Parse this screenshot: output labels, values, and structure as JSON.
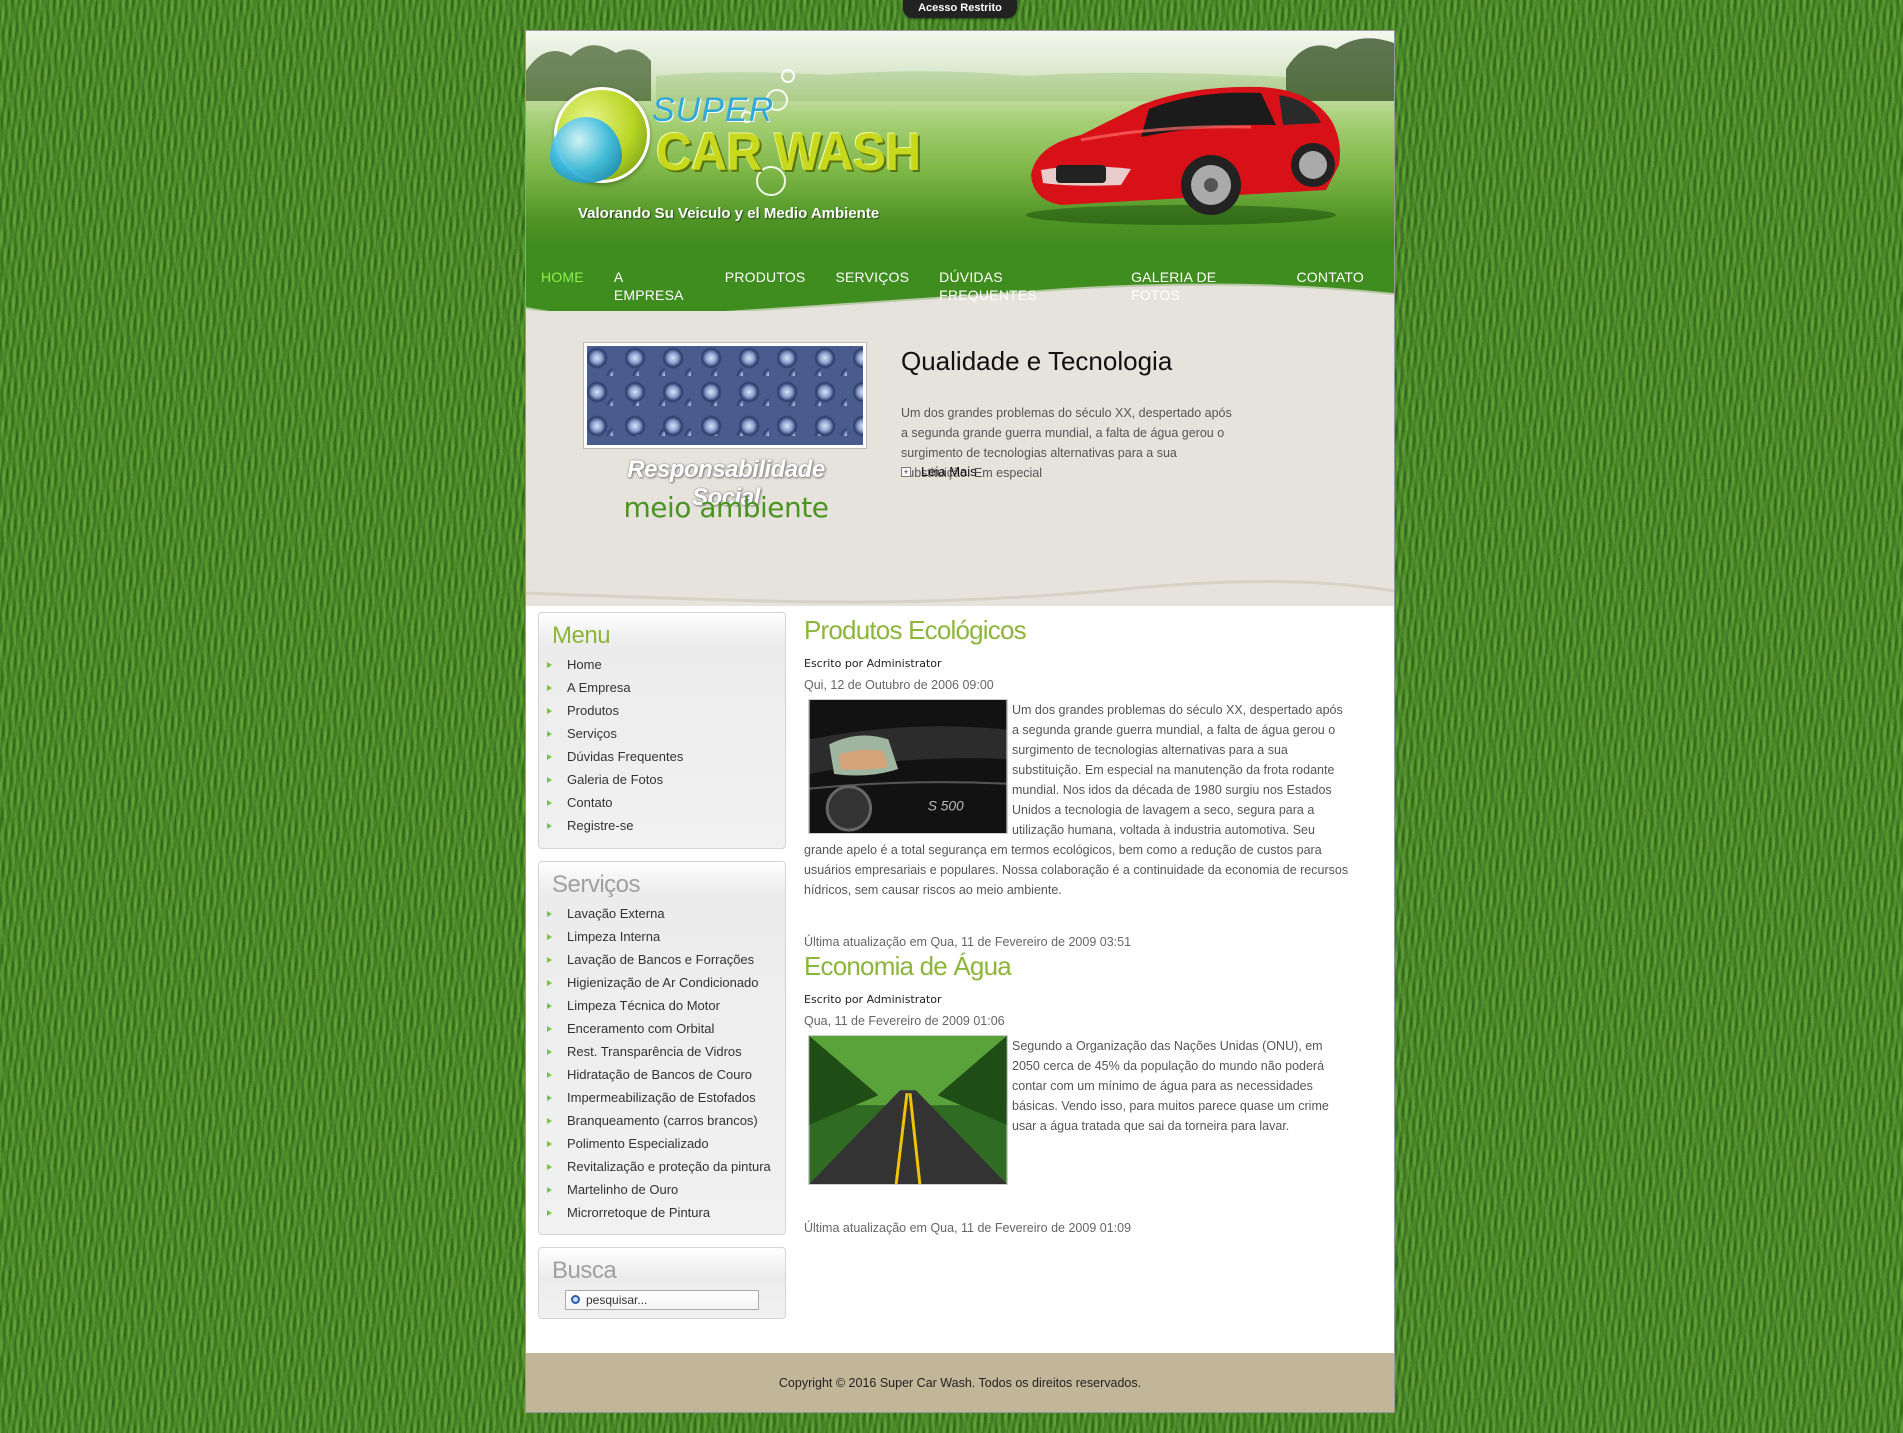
{
  "top_bar": {
    "access_label": "Acesso Restrito"
  },
  "header": {
    "logo_super": "SUPER",
    "logo_name": "CAR WASH",
    "tagline": "Valorando Su Veiculo y el Medio Ambiente"
  },
  "nav": {
    "items": [
      {
        "label": "HOME",
        "active": true
      },
      {
        "label": "A EMPRESA"
      },
      {
        "label": "PRODUTOS"
      },
      {
        "label": "SERVIÇOS"
      },
      {
        "label": "DÚVIDAS FREQUENTES"
      },
      {
        "label": "GALERIA DE FOTOS"
      },
      {
        "label": "CONTATO"
      }
    ]
  },
  "feature": {
    "image_caption_1": "Responsabilidade Social",
    "image_caption_2": "meio ambiente",
    "title": "Qualidade e Tecnologia",
    "text": "Um dos grandes problemas do século XX, despertado após a segunda grande guerra mundial, a falta de água gerou o surgimento de tecnologias alternativas para a sua substituição. Em especial",
    "read_more": "Leia Mais"
  },
  "sidebar": {
    "menu": {
      "title": "Menu",
      "items": [
        "Home",
        "A Empresa",
        "Produtos",
        "Serviços",
        "Dúvidas Frequentes",
        "Galeria de Fotos",
        "Contato",
        "Registre-se"
      ]
    },
    "servicos": {
      "title": "Serviços",
      "items": [
        "Lavação Externa",
        "Limpeza Interna",
        "Lavação de Bancos e Forrações",
        "Higienização de Ar Condicionado",
        "Limpeza Técnica do Motor",
        "Enceramento com Orbital",
        "Rest. Transparência de Vidros",
        "Hidratação de Bancos de Couro",
        "Impermeabilização de Estofados",
        "Branqueamento (carros brancos)",
        "Polimento Especializado",
        "Revitalização e proteção da pintura",
        "Martelinho de Ouro",
        "Microrretoque de Pintura"
      ]
    },
    "busca": {
      "title": "Busca",
      "placeholder": "pesquisar..."
    }
  },
  "articles": [
    {
      "title": "Produtos Ecológicos",
      "author": "Escrito por Administrator",
      "date": "Qui, 12 de Outubro de 2006 09:00",
      "text": "Um dos grandes problemas do século XX, despertado após a segunda grande guerra mundial, a falta de água gerou o surgimento de tecnologias alternativas para a sua substituição. Em especial na manutenção da frota rodante mundial. Nos idos da década de 1980 surgiu nos Estados Unidos a tecnologia de lavagem a seco, segura para a utilização humana, voltada à industria automotiva. Seu grande apelo é a total segurança em termos ecológicos, bem como a redução de custos para usuários empresariais e populares. Nossa colaboração é a continuidade da economia de recursos hídricos, sem causar riscos ao meio ambiente.",
      "updated": "Última atualização em Qua, 11 de Fevereiro de 2009 03:51"
    },
    {
      "title": "Economia de Água",
      "author": "Escrito por Administrator",
      "date": "Qua, 11 de Fevereiro de 2009 01:06",
      "text": "Segundo a Organização das Nações Unidas (ONU), em 2050 cerca de 45% da população do mundo não poderá contar com um mínimo de água para as necessidades básicas. Vendo isso, para muitos parece quase um crime usar a água tratada que sai da torneira para lavar.",
      "updated": "Última atualização em Qua, 11 de Fevereiro de 2009 01:09"
    }
  ],
  "footer": {
    "copyright": "Copyright © 2016 Super Car Wash. Todos os direitos reservados."
  }
}
